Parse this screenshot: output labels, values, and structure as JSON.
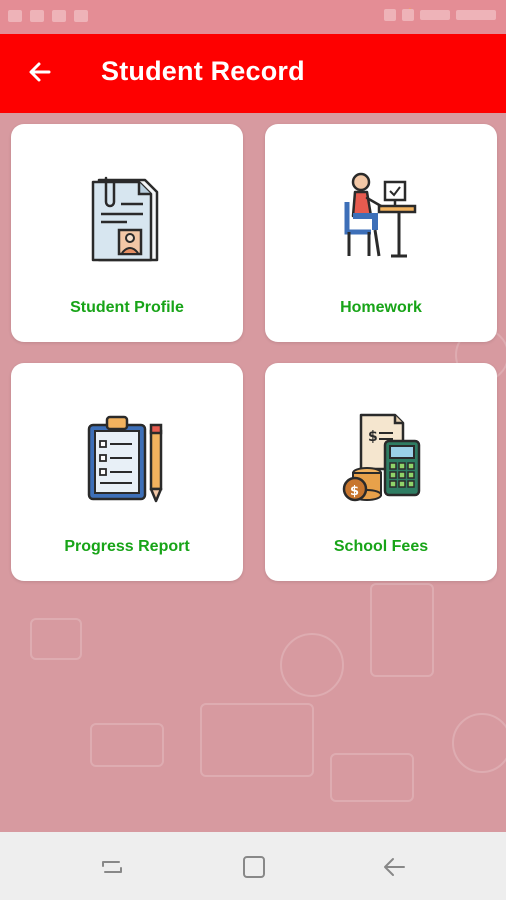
{
  "app_bar": {
    "title": "Student Record",
    "back_icon": "arrow-left-icon",
    "background_color": "#fe0000"
  },
  "menu": {
    "items": [
      {
        "label": "Student Profile",
        "icon": "student-profile-document-icon"
      },
      {
        "label": "Homework",
        "icon": "student-at-desk-icon"
      },
      {
        "label": "Progress Report",
        "icon": "clipboard-checklist-icon"
      },
      {
        "label": "School Fees",
        "icon": "calculator-coins-icon"
      }
    ],
    "label_color": "#18a418"
  },
  "navigation_bar": {
    "buttons": [
      "recent-apps-icon",
      "home-icon",
      "back-icon"
    ]
  }
}
